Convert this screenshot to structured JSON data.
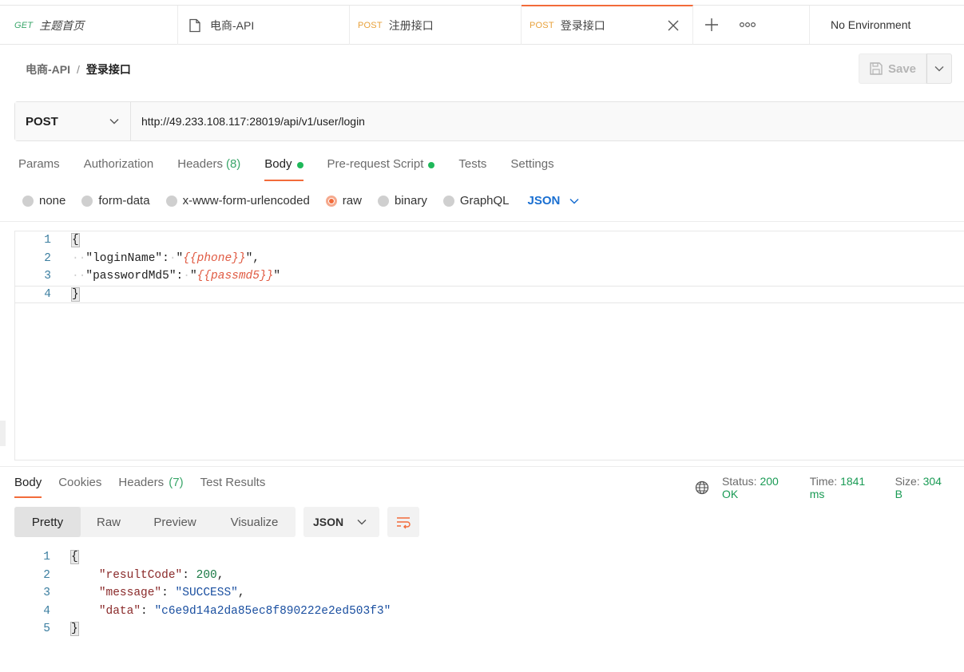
{
  "tabs": [
    {
      "method": "GET",
      "title": "主题首页",
      "kind": "get"
    },
    {
      "method": "",
      "title": "电商-API",
      "kind": "collection"
    },
    {
      "method": "POST",
      "title": "注册接口",
      "kind": "post"
    },
    {
      "method": "POST",
      "title": "登录接口",
      "kind": "post",
      "active": true
    }
  ],
  "tab_actions": {
    "add_icon": "plus-icon",
    "more_icon": "ellipsis-icon"
  },
  "environment": "No Environment",
  "breadcrumb": {
    "parent": "电商-API",
    "separator": "/",
    "current": "登录接口"
  },
  "save": {
    "label": "Save",
    "icon": "save-icon"
  },
  "request": {
    "method": "POST",
    "url": "http://49.233.108.117:28019/api/v1/user/login"
  },
  "request_tabs": {
    "params": "Params",
    "authorization": "Authorization",
    "headers": "Headers",
    "headers_count": "(8)",
    "body": "Body",
    "pre_request": "Pre-request Script",
    "tests": "Tests",
    "settings": "Settings"
  },
  "body_types": {
    "none": "none",
    "form_data": "form-data",
    "urlencoded": "x-www-form-urlencoded",
    "raw": "raw",
    "binary": "binary",
    "graphql": "GraphQL",
    "language": "JSON"
  },
  "request_body": {
    "line_numbers": [
      "1",
      "2",
      "3",
      "4"
    ],
    "open": "{",
    "close": "}",
    "k1": "\"loginName\"",
    "v1": "{{phone}}",
    "k2": "\"passwordMd5\"",
    "v2": "{{passmd5}}"
  },
  "response_tabs": {
    "body": "Body",
    "cookies": "Cookies",
    "headers": "Headers",
    "headers_count": "(7)",
    "test_results": "Test Results"
  },
  "response_meta": {
    "status_label": "Status:",
    "status": "200 OK",
    "time_label": "Time:",
    "time": "1841 ms",
    "size_label": "Size:",
    "size": "304 B"
  },
  "response_view": {
    "pretty": "Pretty",
    "raw": "Raw",
    "preview": "Preview",
    "visualize": "Visualize",
    "format": "JSON"
  },
  "response_body": {
    "line_numbers": [
      "1",
      "2",
      "3",
      "4",
      "5"
    ],
    "open": "{",
    "close": "}",
    "k1": "\"resultCode\"",
    "v1": "200",
    "k2": "\"message\"",
    "v2": "\"SUCCESS\"",
    "k3": "\"data\"",
    "v3": "\"c6e9d14a2da85ec8f890222e2ed503f3\""
  },
  "colors": {
    "accent": "#f26b3a",
    "success": "#1a9b55",
    "link": "#1a6fd1"
  }
}
